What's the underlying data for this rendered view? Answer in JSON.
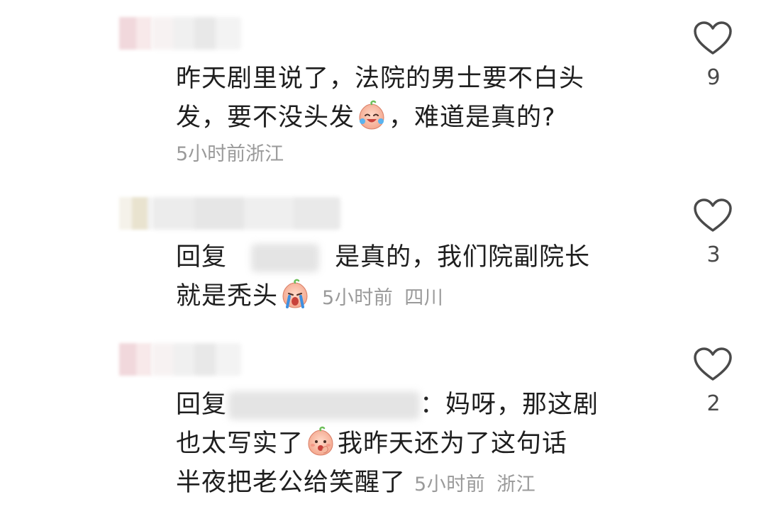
{
  "comments": [
    {
      "text_line1": "昨天剧里说了，法院的男士要不白头",
      "text_line2a": "发，要不没头发",
      "emoji": "crying-laughing-peach-emoji",
      "text_line2b": "，难道是真的?",
      "time": "5小时前",
      "location": "浙江",
      "likes": "9"
    },
    {
      "reply_prefix": "回复",
      "text_line1": "是真的，我们院副院长",
      "text_line2": "就是秃头",
      "emoji": "crying-peach-emoji",
      "time": "5小时前",
      "location": "四川",
      "likes": "3"
    },
    {
      "reply_prefix": "回复",
      "text_line1": "：妈呀，那这剧",
      "text_line2a": "也太写实了",
      "emoji": "shy-peach-emoji",
      "text_line2b": "我昨天还为了这句话",
      "text_line3": "半夜把老公给笑醒了",
      "time": "5小时前",
      "location": "浙江",
      "likes": "2"
    }
  ],
  "icons": {
    "like": "heart-outline-icon"
  },
  "colors": {
    "text": "#1e1e1e",
    "meta": "#9a9a9a",
    "icon": "#4a4a4a"
  }
}
